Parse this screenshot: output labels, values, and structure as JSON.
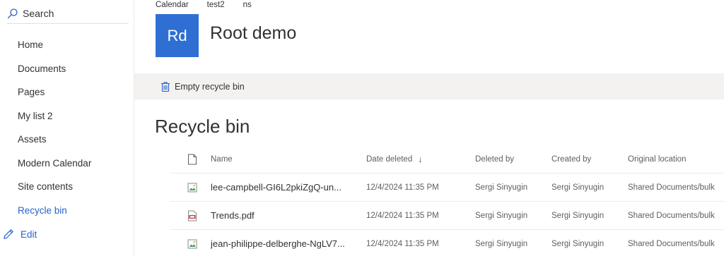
{
  "sidebar": {
    "search_label": "Search",
    "items": [
      {
        "label": "Home"
      },
      {
        "label": "Documents"
      },
      {
        "label": "Pages"
      },
      {
        "label": "My list 2"
      },
      {
        "label": "Assets"
      },
      {
        "label": "Modern Calendar"
      },
      {
        "label": "Site contents"
      },
      {
        "label": "Recycle bin",
        "active": true
      }
    ],
    "edit_label": "Edit"
  },
  "header": {
    "nav": [
      "Calendar",
      "test2",
      "ns"
    ],
    "logo_text": "Rd",
    "site_title": "Root demo"
  },
  "commandbar": {
    "empty_label": "Empty recycle bin"
  },
  "page": {
    "title": "Recycle bin"
  },
  "table": {
    "columns": {
      "name": "Name",
      "date_deleted": "Date deleted",
      "deleted_by": "Deleted by",
      "created_by": "Created by",
      "original_location": "Original location"
    },
    "sort_indicator": "↓",
    "rows": [
      {
        "icon": "image-file-icon",
        "name": "lee-campbell-GI6L2pkiZgQ-un...",
        "date_deleted": "12/4/2024 11:35 PM",
        "deleted_by": "Sergi Sinyugin",
        "created_by": "Sergi Sinyugin",
        "original_location": "Shared Documents/bulk"
      },
      {
        "icon": "pdf-file-icon",
        "name": "Trends.pdf",
        "date_deleted": "12/4/2024 11:35 PM",
        "deleted_by": "Sergi Sinyugin",
        "created_by": "Sergi Sinyugin",
        "original_location": "Shared Documents/bulk"
      },
      {
        "icon": "image-file-icon",
        "name": "jean-philippe-delberghe-NgLV7...",
        "date_deleted": "12/4/2024 11:35 PM",
        "deleted_by": "Sergi Sinyugin",
        "created_by": "Sergi Sinyugin",
        "original_location": "Shared Documents/bulk"
      }
    ]
  },
  "colors": {
    "accent": "#2563c9",
    "logo_bg": "#2f6fd3",
    "commandbar_bg": "#f3f2f1"
  }
}
